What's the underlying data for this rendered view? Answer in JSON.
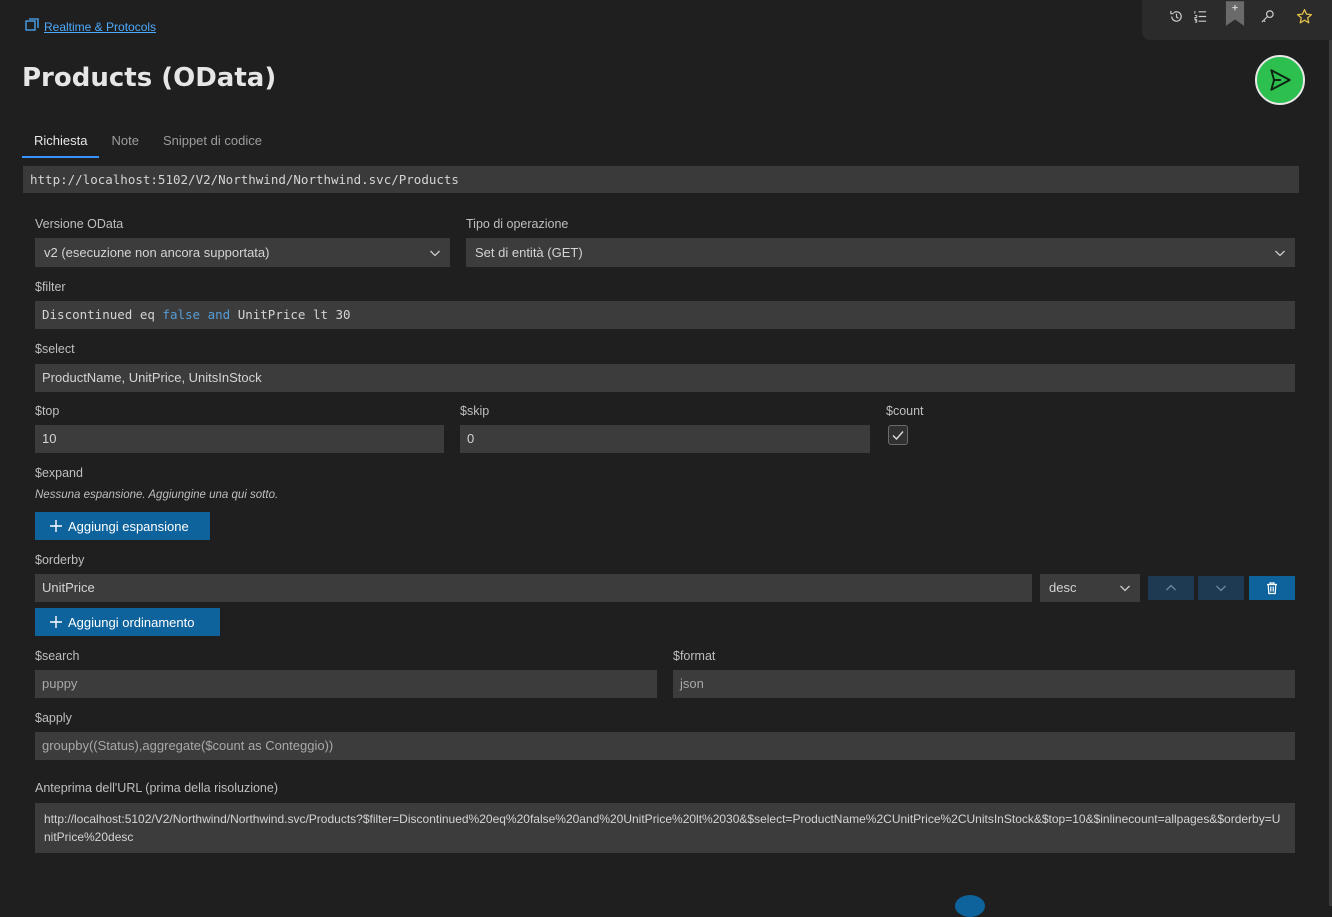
{
  "breadcrumb": {
    "label": "Realtime & Protocols"
  },
  "title": "Products (OData)",
  "tabs": [
    "Richiesta",
    "Note",
    "Snippet di codice"
  ],
  "url": "http://localhost:5102/V2/Northwind/Northwind.svc/Products",
  "odata_version": {
    "label": "Versione OData",
    "value": "v2 (esecuzione non ancora supportata)"
  },
  "operation": {
    "label": "Tipo di operazione",
    "value": "Set di entità (GET)"
  },
  "filter": {
    "label": "$filter",
    "tokens": {
      "t1": "Discontinued eq ",
      "t2": "false",
      "t3": " ",
      "t4": "and",
      "t5": " UnitPrice lt 30"
    }
  },
  "select": {
    "label": "$select",
    "value": "ProductName, UnitPrice, UnitsInStock"
  },
  "top": {
    "label": "$top",
    "value": "10"
  },
  "skip": {
    "label": "$skip",
    "value": "0"
  },
  "count": {
    "label": "$count",
    "checked": true
  },
  "expand": {
    "label": "$expand",
    "empty_text": "Nessuna espansione. Aggiungine una qui sotto.",
    "add_label": "Aggiungi espansione"
  },
  "orderby": {
    "label": "$orderby",
    "field": "UnitPrice",
    "direction": "desc",
    "add_label": "Aggiungi ordinamento"
  },
  "search": {
    "label": "$search",
    "value": "puppy"
  },
  "format": {
    "label": "$format",
    "value": "json"
  },
  "apply": {
    "label": "$apply",
    "value": "groupby((Status),aggregate($count as Conteggio))"
  },
  "preview": {
    "label": "Anteprima dell'URL (prima della risoluzione)",
    "value": "http://localhost:5102/V2/Northwind/Northwind.svc/Products?$filter=Discontinued%20eq%20false%20and%20UnitPrice%20lt%2030&$select=ProductName%2CUnitPrice%2CUnitsInStock&$top=10&$inlinecount=allpages&$orderby=UnitPrice%20desc"
  },
  "toolbar_icons": [
    "history-icon",
    "list-icon",
    "bookmark-icon",
    "key-icon",
    "star-icon"
  ],
  "colors": {
    "accent": "#0e639c",
    "send": "#2ec04f",
    "link": "#4daafc",
    "keyword": "#569cd6",
    "star": "#e2c04b"
  }
}
